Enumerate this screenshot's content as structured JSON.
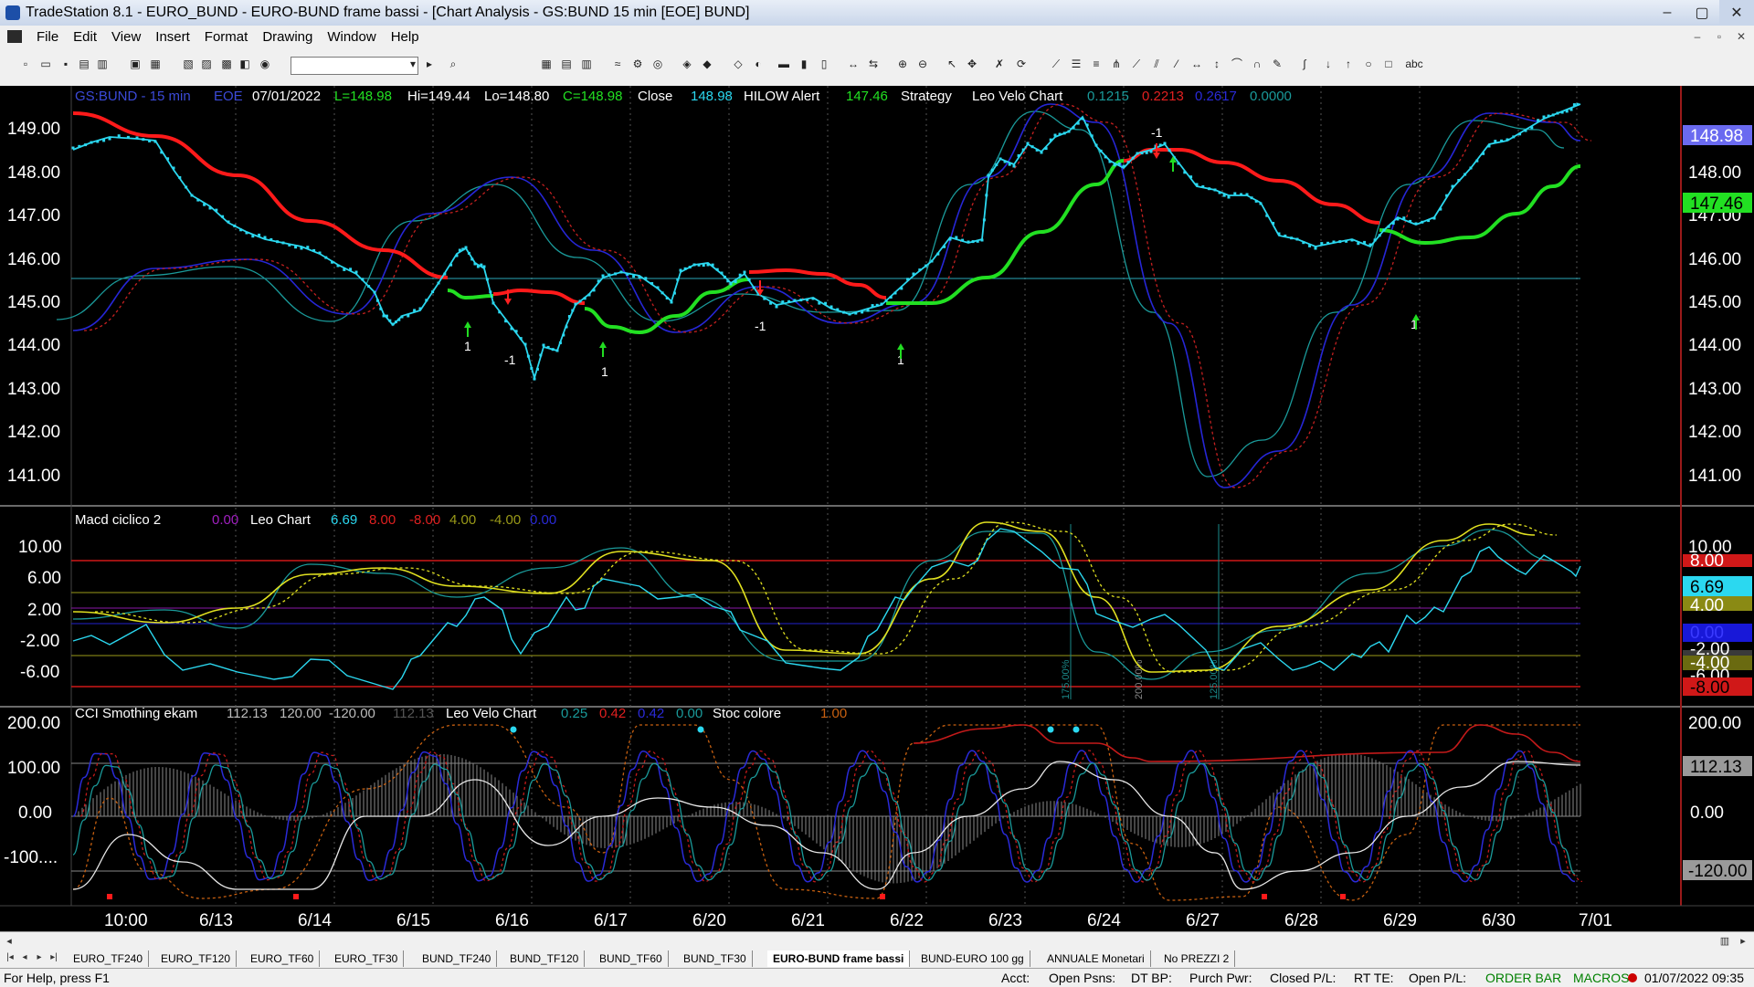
{
  "window": {
    "title": "TradeStation 8.1 - EURO_BUND - EURO-BUND frame bassi - [Chart Analysis - GS:BUND  15 min  [EOE] BUND]",
    "controls": [
      "–",
      "▢",
      "✕"
    ]
  },
  "menu": [
    "File",
    "Edit",
    "View",
    "Insert",
    "Format",
    "Drawing",
    "Window",
    "Help"
  ],
  "mdi_controls": [
    "–",
    "▫",
    "✕"
  ],
  "panel1": {
    "symbol": "GS:BUND - 15 min",
    "session": "EOE",
    "date": "07/01/2022",
    "last": "L=148.98",
    "high": "Hi=149.44",
    "low": "Lo=148.80",
    "close_eq": "C=148.98",
    "close_label": "Close",
    "close_val": "148.98",
    "hilow_label": "HILOW Alert",
    "hilow_val": "147.46",
    "strategy_label": "Strategy",
    "leo_label": "Leo Velo Chart",
    "leo_v1": "0.1215",
    "leo_v2": "0.2213",
    "leo_v3": "0.2617",
    "leo_v4": "0.0000",
    "yticks": [
      "149.00",
      "148.00",
      "147.00",
      "146.00",
      "145.00",
      "144.00",
      "143.00",
      "142.00",
      "141.00"
    ],
    "badge_close": "148.98",
    "badge_hilow": "147.46",
    "signals": [
      "1",
      "-1",
      "1",
      "-1",
      "1",
      "-1",
      "1"
    ]
  },
  "panel2": {
    "name": "Macd ciclico 2",
    "v1": "0.00",
    "leo_label": "Leo Chart",
    "v2": "6.69",
    "v3": "8.00",
    "v4": "-8.00",
    "v5": "4.00",
    "v6": "-4.00",
    "v7": "0.00",
    "yticks": [
      "10.00",
      "6.00",
      "2.00",
      "-2.00",
      "-6.00"
    ],
    "badges": [
      "8.00",
      "6.69",
      "4.00",
      "0.00",
      "-2.00",
      "-4.00",
      "-6.00",
      "-8.00"
    ],
    "vlabels": [
      "175.00%",
      "200.00%",
      "125.00%"
    ]
  },
  "panel3": {
    "name": "CCI Smothing ekam",
    "v1": "112.13",
    "v2": "120.00",
    "v3": "-120.00",
    "v4": "112.13",
    "leo_label": "Leo Velo Chart",
    "v5": "0.25",
    "v6": "0.42",
    "v7": "0.42",
    "v8": "0.00",
    "stoc_label": "Stoc colore",
    "v9": "1.00",
    "yticks": [
      "200.00",
      "100.00",
      "0.00",
      "-100...."
    ],
    "badges": [
      "200.00",
      "112.13",
      "0.00",
      "-120.00"
    ]
  },
  "xaxis": [
    "10:00",
    "6/13",
    "6/14",
    "6/15",
    "6/16",
    "6/17",
    "6/20",
    "6/21",
    "6/22",
    "6/23",
    "6/24",
    "6/27",
    "6/28",
    "6/29",
    "6/30",
    "7/01"
  ],
  "tabs": [
    "EURO_TF240",
    "EURO_TF120",
    "EURO_TF60",
    "EURO_TF30",
    "BUND_TF240",
    "BUND_TF120",
    "BUND_TF60",
    "BUND_TF30",
    "EURO-BUND frame bassi",
    "BUND-EURO 100 gg",
    "ANNUALE Monetari",
    "No PREZZI 2"
  ],
  "active_tab": "EURO-BUND frame bassi",
  "status": {
    "help": "For Help, press F1",
    "acct": "Acct:",
    "open_psns": "Open Psns:",
    "dt_bp": "DT BP:",
    "purch_pwr": "Purch Pwr:",
    "closed_pl": "Closed P/L:",
    "rt_te": "RT TE:",
    "open_pl": "Open P/L:",
    "order_bar": "ORDER BAR",
    "macros": "MACROS",
    "datetime": "01/07/2022 09:35"
  },
  "colors": {
    "price": "#2bd8f0",
    "hilow_up": "#22e022",
    "hilow_down": "#ff1a1a",
    "leo_blue": "#2222cc",
    "leo_red": "#cc2222",
    "leo_teal": "#1a8a8a",
    "yellow": "#e0e020",
    "axis_text": "#ffffff"
  }
}
